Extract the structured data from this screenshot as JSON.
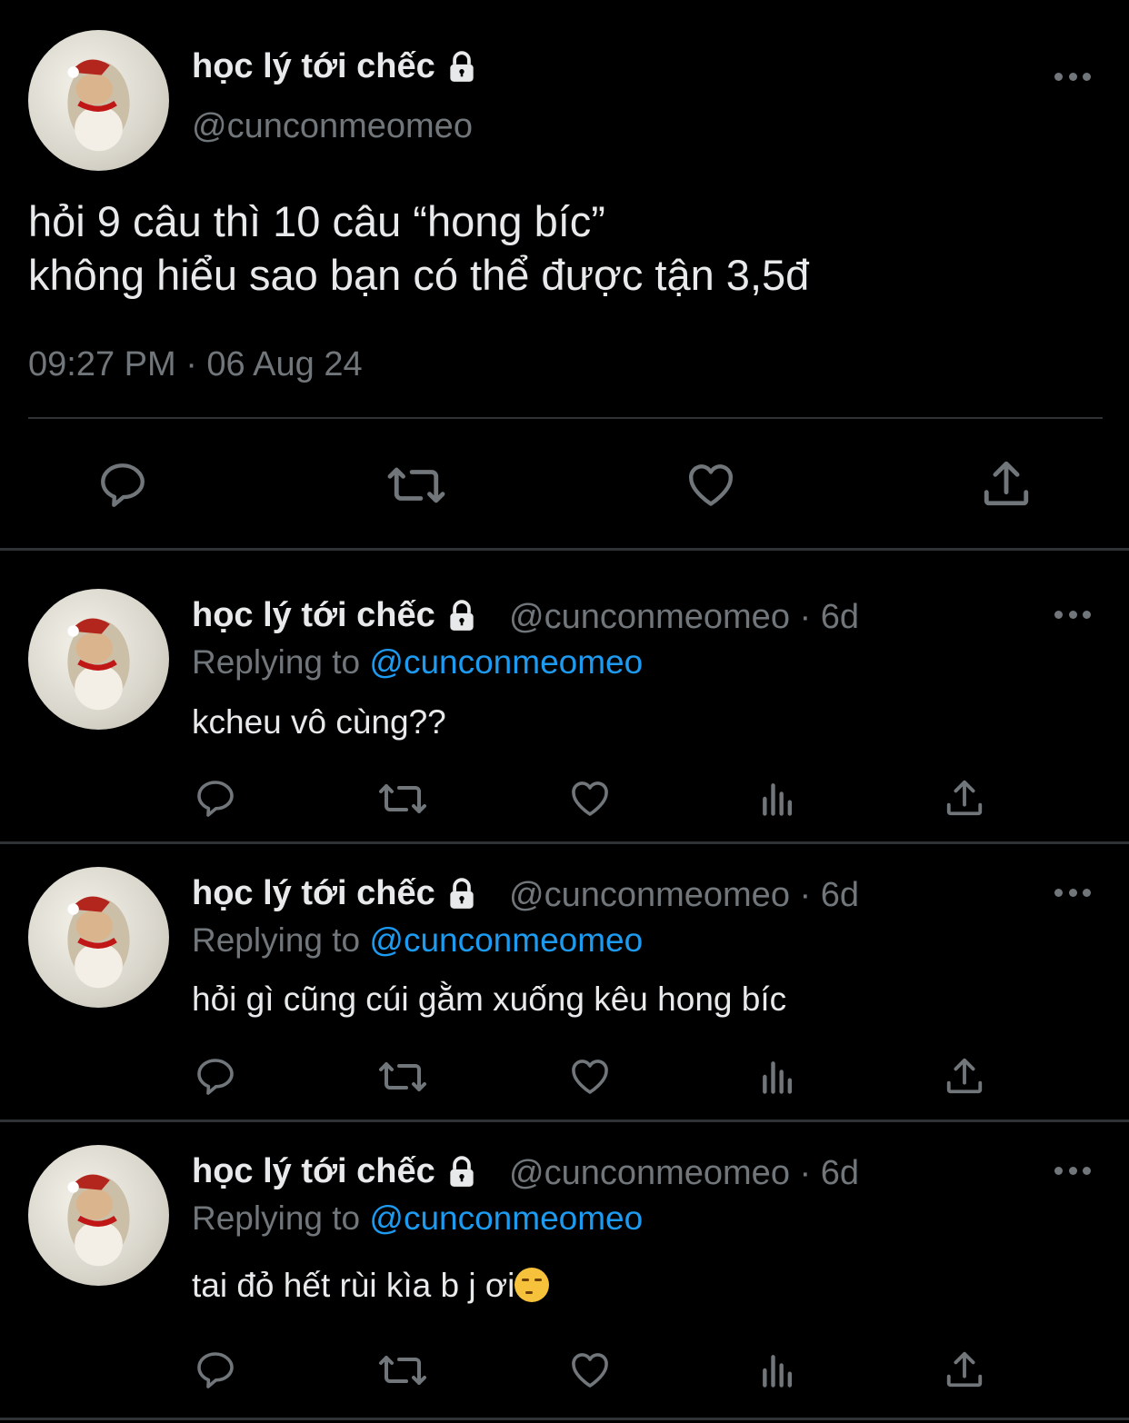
{
  "main_tweet": {
    "name": "học lý tới chếc",
    "handle": "@cunconmeomeo",
    "text": "hỏi 9 câu thì 10 câu “hong bíc”\nkhông hiểu sao bạn có thể được tận 3,5đ",
    "timestamp": "09:27 PM · 06 Aug 24"
  },
  "replies": [
    {
      "name": "học lý tới chếc",
      "handle_time": "@cunconmeomeo · 6d",
      "replying_prefix": "Replying to ",
      "replying_to": "@cunconmeomeo",
      "text": "kcheu vô cùng??"
    },
    {
      "name": "học lý tới chếc",
      "handle_time": "@cunconmeomeo · 6d",
      "replying_prefix": "Replying to ",
      "replying_to": "@cunconmeomeo",
      "text": "hỏi gì cũng cúi gằm xuống kêu hong bíc"
    },
    {
      "name": "học lý tới chếc",
      "handle_time": "@cunconmeomeo · 6d",
      "replying_prefix": "Replying to ",
      "replying_to": "@cunconmeomeo",
      "text": "tai đỏ hết rùi kìa b j ơi"
    }
  ],
  "icons": {
    "reply": "speech-bubble-icon",
    "retweet": "retweet-arrows-icon",
    "like": "heart-icon",
    "views": "bar-chart-icon",
    "share": "upload-arrow-icon",
    "more": "three-dots-icon",
    "lock": "lock-icon",
    "emoji": "smirking-face-emoji"
  },
  "colors": {
    "background": "#000000",
    "primary_text": "#e7e9ea",
    "secondary_text": "#71767b",
    "mention": "#1d9bf0",
    "divider": "#2f3336"
  }
}
